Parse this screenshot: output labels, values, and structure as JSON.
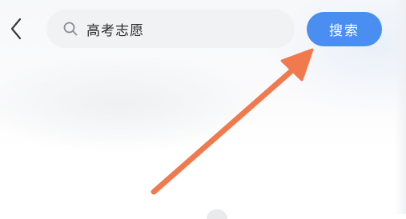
{
  "header": {
    "back_icon": "chevron-left-icon",
    "search": {
      "icon": "search-icon",
      "value": "高考志愿",
      "placeholder": ""
    },
    "search_button_label": "搜索"
  },
  "annotation": {
    "arrow_color": "#f07a4e",
    "target": "search-button"
  },
  "colors": {
    "accent": "#4b8ef2",
    "search_bg": "#f1f2f4",
    "text": "#2b2b2b"
  }
}
